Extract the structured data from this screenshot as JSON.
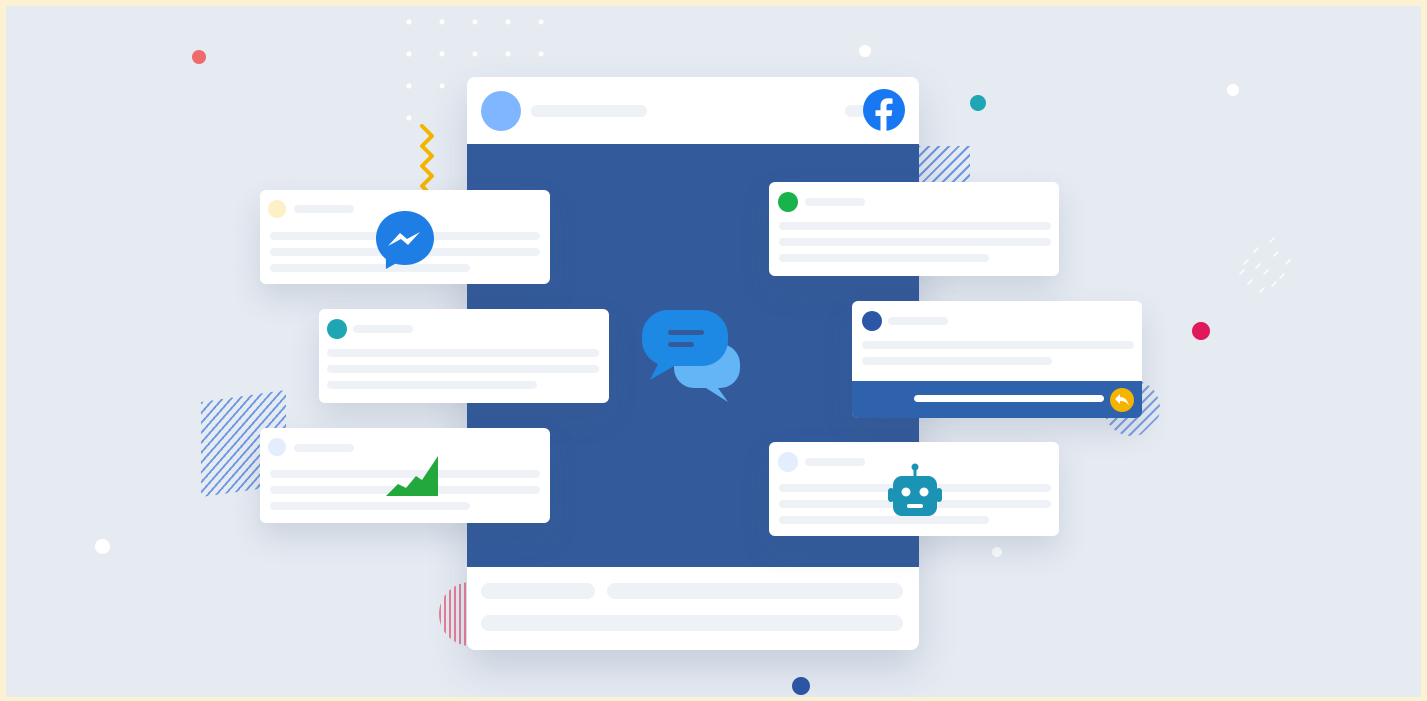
{
  "colors": {
    "background": "#e6ebf2",
    "frame": "#fdf1d3",
    "post_blue": "#335b9c",
    "facebook_blue": "#1877f2",
    "messenger_blue": "#1e7ee6",
    "chart_green": "#22a83c",
    "robot_teal": "#1b93b5",
    "reply_yellow": "#f4b400",
    "accent_red": "#ef6a6a",
    "accent_pink": "#e0195b",
    "accent_teal": "#1ea6b5"
  },
  "icons": {
    "post_logo": "facebook-icon",
    "messenger": "messenger-icon",
    "chat": "chat-bubbles-icon",
    "chart": "growth-chart-icon",
    "robot": "robot-icon",
    "reply": "reply-arrow-icon"
  }
}
